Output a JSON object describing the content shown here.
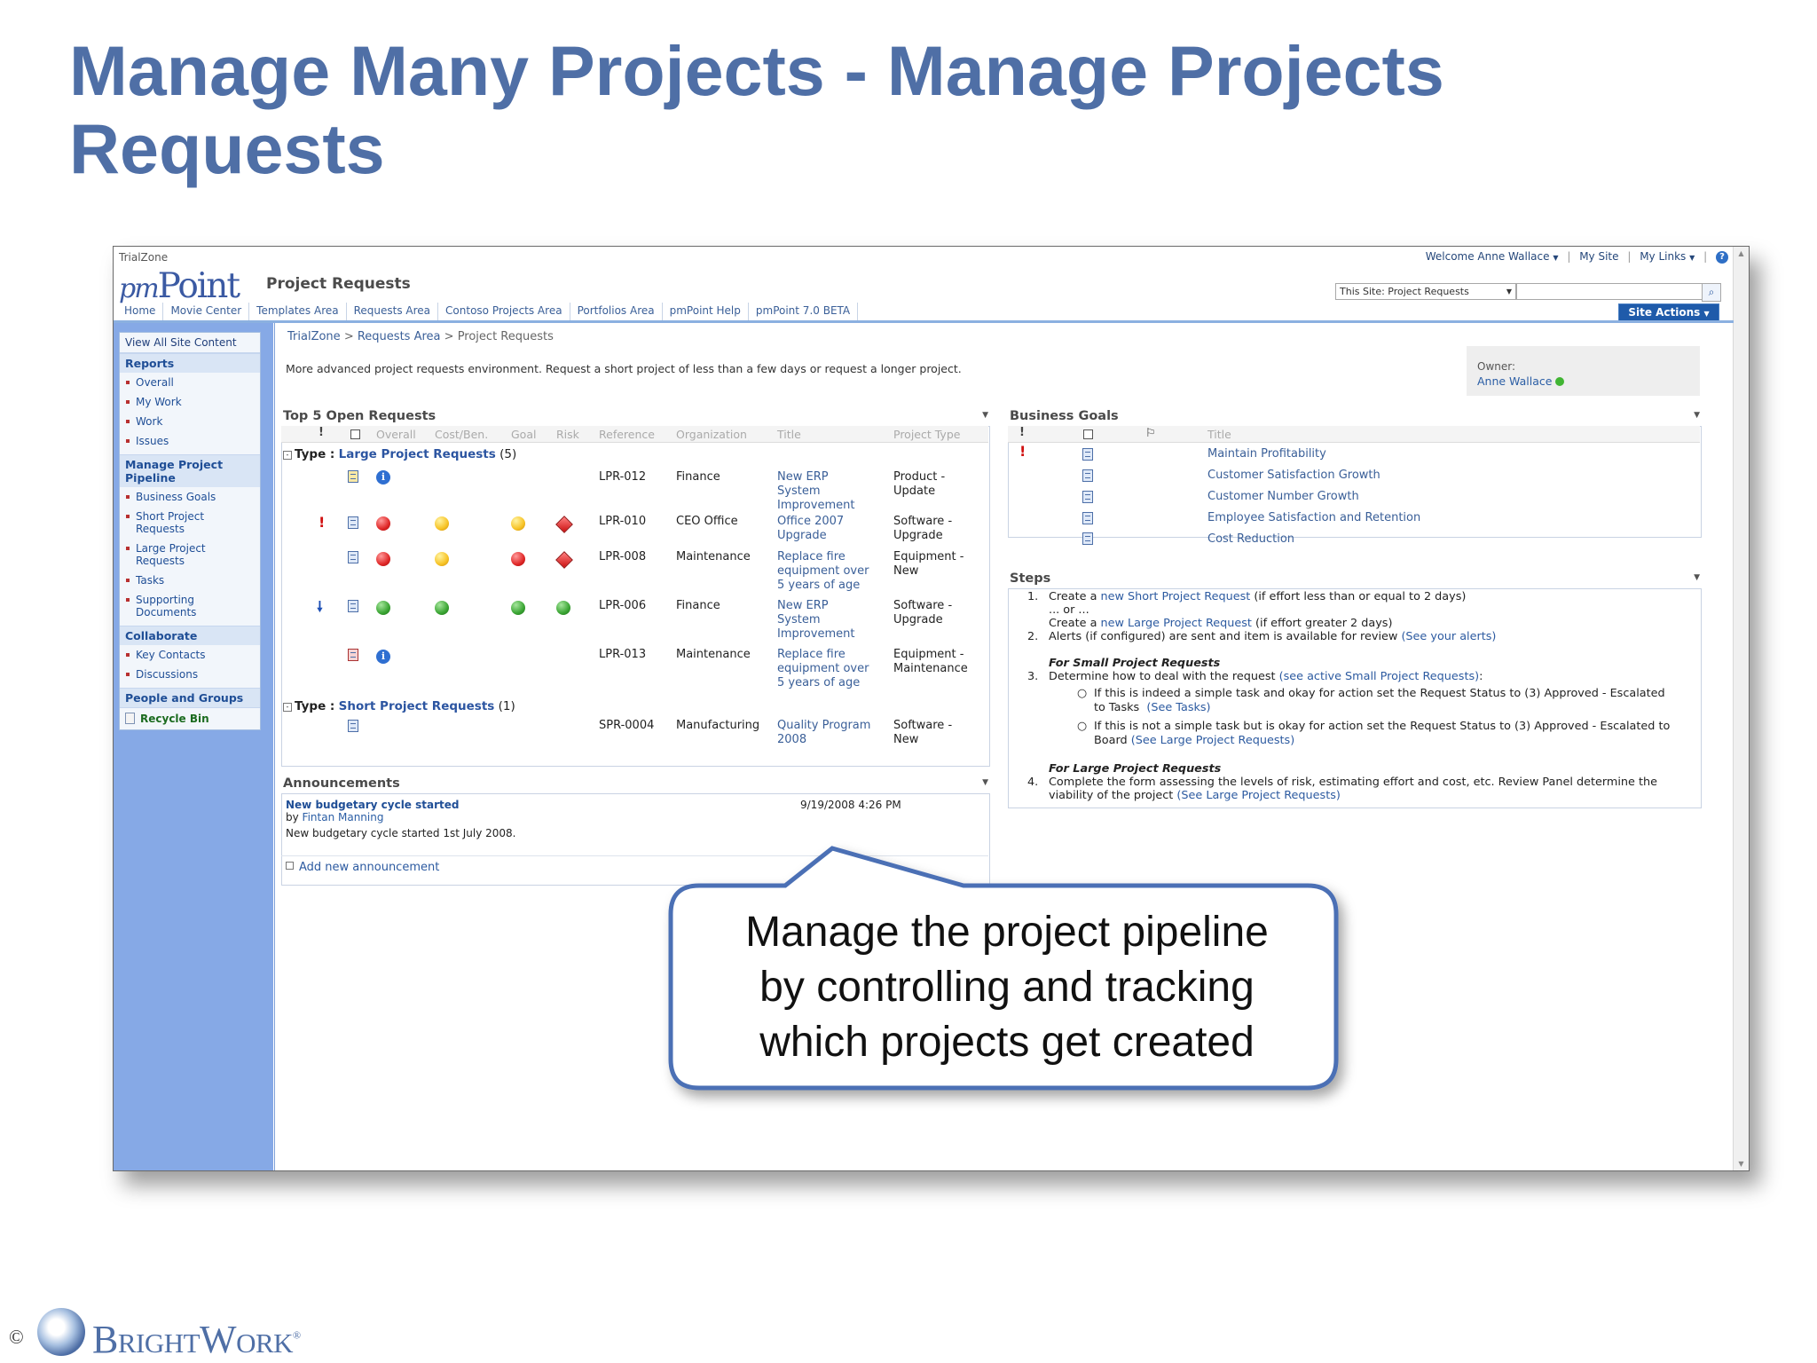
{
  "slide": {
    "title_line1": "Manage Many Projects - Manage Projects",
    "title_line2": "Requests",
    "callout_lines": [
      "Manage the project pipeline",
      "by controlling and tracking",
      "which projects get created"
    ],
    "footer": {
      "copyright": "©",
      "brand": "BrightWork",
      "reg": "®"
    }
  },
  "window": {
    "site_name": "TrialZone",
    "welcome": "Welcome Anne Wallace",
    "my_site": "My Site",
    "my_links": "My Links",
    "help_glyph": "?",
    "logo_pm": "pm",
    "logo_point": "Point",
    "page_title": "Project Requests",
    "search_scope": "This Site: Project Requests",
    "search_placeholder": "",
    "site_actions": "Site Actions",
    "tabs": [
      "Home",
      "Movie Center",
      "Templates Area",
      "Requests Area",
      "Contoso Projects Area",
      "Portfolios Area",
      "pmPoint Help",
      "pmPoint 7.0 BETA"
    ]
  },
  "quicklaunch": {
    "view_all": "View All Site Content",
    "reports_head": "Reports",
    "reports": [
      "Overall",
      "My Work",
      "Work",
      "Issues"
    ],
    "pipeline_head": "Manage Project Pipeline",
    "pipeline": [
      "Business Goals",
      "Short Project Requests",
      "Large Project Requests",
      "Tasks",
      "Supporting Documents"
    ],
    "collab_head": "Collaborate",
    "collab": [
      "Key Contacts",
      "Discussions"
    ],
    "people_head": "People and Groups",
    "recycle": "Recycle Bin"
  },
  "main": {
    "breadcrumb": [
      "TrialZone",
      "Requests Area",
      "Project Requests"
    ],
    "breadcrumb_sep": ">",
    "description": "More advanced project requests environment. Request a short project of less than a few days or request a longer project.",
    "owner_label": "Owner:",
    "owner_name": "Anne Wallace"
  },
  "top5": {
    "title": "Top 5 Open Requests",
    "columns": [
      "Overall",
      "Cost/Ben.",
      "Goal",
      "Risk",
      "Reference",
      "Organization",
      "Title",
      "Project Type"
    ],
    "group1": {
      "label": "Type :",
      "name": "Large Project Requests",
      "count": "(5)"
    },
    "group2": {
      "label": "Type :",
      "name": "Short Project Requests",
      "count": "(1)"
    },
    "rows": [
      {
        "ref": "LPR-012",
        "org": "Finance",
        "title": [
          "New ERP",
          "System",
          "Improvement"
        ],
        "type": [
          "Product -",
          "Update"
        ]
      },
      {
        "ref": "LPR-010",
        "org": "CEO Office",
        "title": [
          "Office 2007",
          "Upgrade"
        ],
        "type": [
          "Software -",
          "Upgrade"
        ]
      },
      {
        "ref": "LPR-008",
        "org": "Maintenance",
        "title": [
          "Replace fire",
          "equipment over",
          "5 years of age"
        ],
        "type": [
          "Equipment -",
          "New"
        ]
      },
      {
        "ref": "LPR-006",
        "org": "Finance",
        "title": [
          "New ERP",
          "System",
          "Improvement"
        ],
        "type": [
          "Software -",
          "Upgrade"
        ]
      },
      {
        "ref": "LPR-013",
        "org": "Maintenance",
        "title": [
          "Replace fire",
          "equipment over",
          "5 years of age"
        ],
        "type": [
          "Equipment -",
          "Maintenance"
        ]
      },
      {
        "ref": "SPR-0004",
        "org": "Manufacturing",
        "title": [
          "Quality Program",
          "2008"
        ],
        "type": [
          "Software -",
          "New"
        ]
      }
    ],
    "status": {
      "r1": [
        "info"
      ],
      "r2": [
        "red",
        "yellow",
        "yellow",
        "diamond"
      ],
      "r3": [
        "red",
        "yellow",
        "red",
        "diamond"
      ],
      "r4": [
        "green",
        "green",
        "green",
        "green"
      ],
      "r5": [
        "info"
      ]
    }
  },
  "goals": {
    "title": "Business Goals",
    "col_title": "Title",
    "items": [
      "Maintain Profitability",
      "Customer Satisfaction Growth",
      "Customer Number Growth",
      "Employee Satisfaction and Retention",
      "Cost Reduction"
    ]
  },
  "steps": {
    "title": "Steps",
    "n1": "1.",
    "s1a_pre": "Create a",
    "s1a_link": "new Short Project Request",
    "s1a_post": "(if effort less than or equal to 2 days)",
    "s1_or": "... or ...",
    "s1b_pre": "Create a",
    "s1b_link": "new Large Project Request",
    "s1b_post": "(if effort greater 2 days)",
    "n2": "2.",
    "s2_pre": "Alerts (if configured) are sent and item is available for review",
    "s2_link": "(See your alerts)",
    "small_head": "For Small Project Requests",
    "n3": "3.",
    "s3_pre": "Determine how to deal with the request",
    "s3_link": "(see active Small Project Requests)",
    "s3_post": ":",
    "s3a_l1": "If this is indeed a simple task and okay for action set the Request Status to (3) Approved - Escalated",
    "s3a_l2": "to Tasks",
    "s3a_link": "(See Tasks)",
    "s3b_l1": "If this is not a simple task but is okay for action set the Request Status to (3) Approved - Escalated to",
    "s3b_l2": "Board",
    "s3b_link": "(See Large Project Requests)",
    "large_head": "For Large Project Requests",
    "n4": "4.",
    "s4_l1": "Complete the form assessing the levels of risk, estimating effort and cost, etc. Review Panel determine the",
    "s4_l2": "viability of the project",
    "s4_link": "(See Large Project Requests)"
  },
  "announcements": {
    "title": "Announcements",
    "item_title": "New budgetary cycle started",
    "item_date": "9/19/2008 4:26 PM",
    "by": "by",
    "author": "Fintan Manning",
    "body": "New budgetary cycle started 1st July 2008.",
    "add_new": "Add new announcement"
  }
}
